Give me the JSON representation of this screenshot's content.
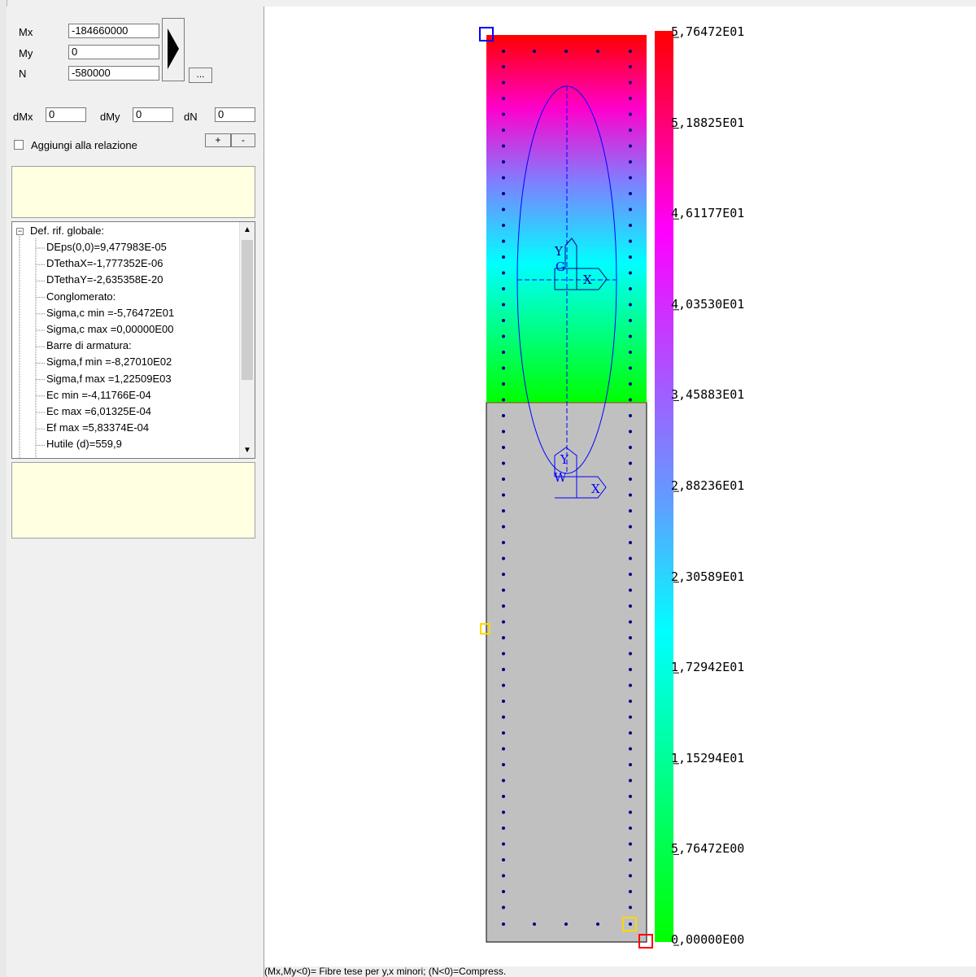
{
  "inputs": {
    "mx": {
      "label": "Mx",
      "value": "-184660000"
    },
    "my": {
      "label": "My",
      "value": "0"
    },
    "n": {
      "label": "N",
      "value": "-580000"
    },
    "dmx": {
      "label": "dMx",
      "value": "0"
    },
    "dmy": {
      "label": "dMy",
      "value": "0"
    },
    "dn": {
      "label": "dN",
      "value": "0"
    }
  },
  "buttons": {
    "ellipsis": "...",
    "plus": "+",
    "minus": "-"
  },
  "checkbox": {
    "label": "Aggiungi alla relazione",
    "checked": false
  },
  "tree": {
    "root": "Def. rif. globale:",
    "items": [
      "DEps(0,0)=9,477983E-05",
      "DTethaX=-1,777352E-06",
      "DTethaY=-2,635358E-20",
      "Conglomerato:",
      "Sigma,c min =-5,76472E01",
      "Sigma,c max =0,00000E00",
      "Barre di armatura:",
      "Sigma,f min =-8,27010E02",
      "Sigma,f max =1,22509E03",
      "Ec min =-4,11766E-04",
      "Ec max =6,01325E-04",
      "Ef max =5,83374E-04",
      "Hutile (d)=559,9"
    ]
  },
  "status_text": "(Mx,My<0)= Fibre tese per y,x minori; (N<0)=Compress.",
  "scale": {
    "labels": [
      "5,76472E01",
      "5,18825E01",
      "4,61177E01",
      "4,03530E01",
      "3,45883E01",
      "2,88236E01",
      "2,30589E01",
      "1,72942E01",
      "1,15294E01",
      "5,76472E00",
      "0,00000E00"
    ]
  },
  "section_marks": {
    "centroid": "G",
    "neutral": "W",
    "axis_x": "X",
    "axis_y": "Y"
  },
  "colors": {
    "stress_top": "#ff0000",
    "stress_mid": "#00ffff",
    "section_gray": "#c0c0c0",
    "rebar": "#000080",
    "overlay": "#0000ff"
  }
}
